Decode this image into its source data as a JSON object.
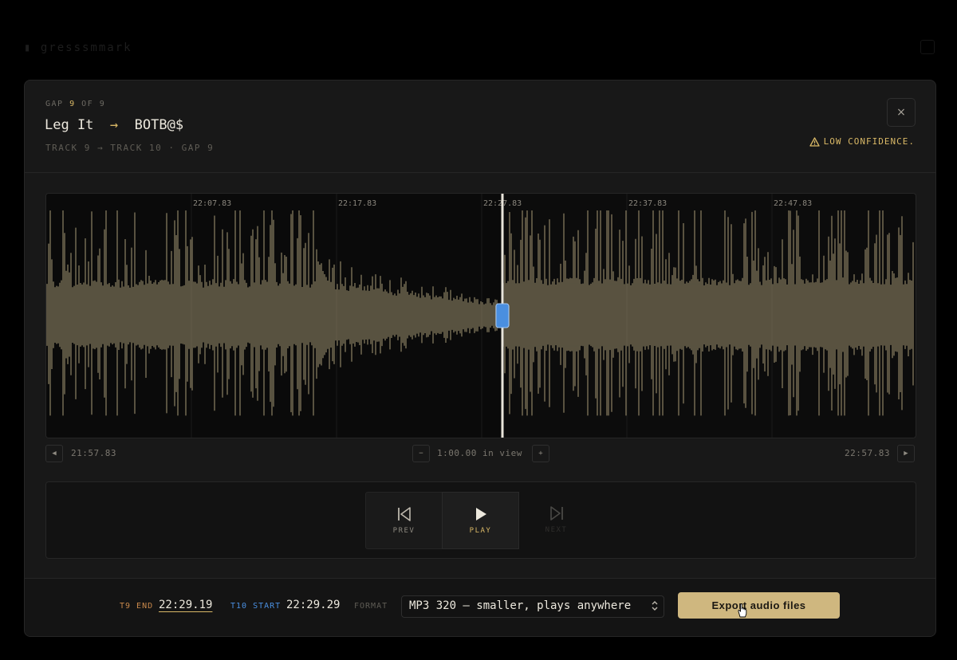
{
  "background": {
    "app_title": "▮ gresssmmark"
  },
  "header": {
    "gap_prefix": "GAP",
    "gap_number": "9",
    "gap_suffix": "OF 9",
    "from_track": "Leg It",
    "arrow": "→",
    "to_track": "BOTB@$",
    "subtitle": "TRACK 9 → TRACK 10 · GAP 9",
    "close_label": "×",
    "warning": "LOW CONFIDENCE."
  },
  "waveform": {
    "time_labels": [
      "22:07.83",
      "22:17.83",
      "22:27.83",
      "22:37.83",
      "22:47.83"
    ],
    "view_start": "21:57.83",
    "view_end": "22:57.83",
    "view_span": "1:00.00 in view",
    "cut_position": 0.525,
    "colors": {
      "wave": "#7a7157",
      "cut": "#4a8fe0",
      "background": "#0c0c0c"
    }
  },
  "transport": {
    "prev_label": "PREV",
    "play_label": "PLAY",
    "next_label": "NEXT"
  },
  "footer": {
    "t9_label": "T9 END",
    "t9_value": "22:29.19",
    "t10_label": "T10 START",
    "t10_value": "22:29.29",
    "format_label": "FORMAT",
    "format_value": "MP3 320 — smaller, plays anywhere",
    "export_label": "Export audio files"
  },
  "colors": {
    "accent": "#d9b866",
    "blue": "#4a8fe0",
    "orange": "#c9894b"
  }
}
